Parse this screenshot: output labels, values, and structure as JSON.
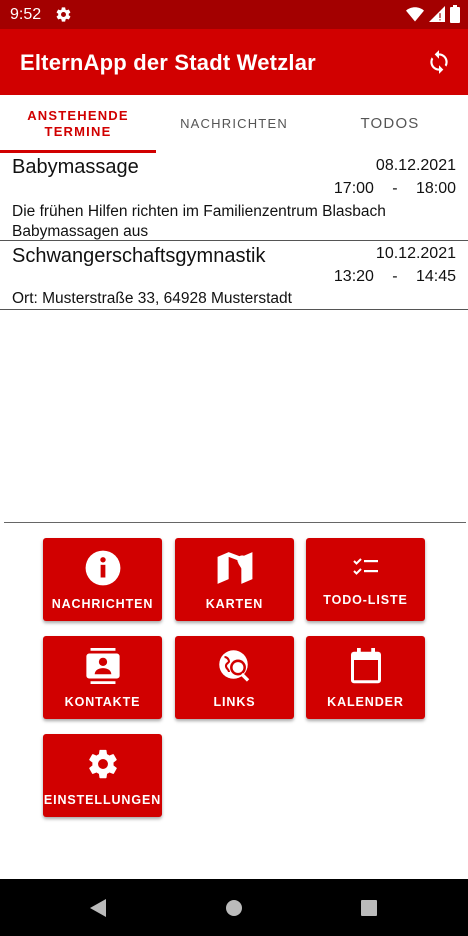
{
  "status_bar": {
    "time": "9:52"
  },
  "app_bar": {
    "title": "ElternApp der Stadt Wetzlar"
  },
  "tabs": [
    {
      "label": "ANSTEHENDE TERMINE",
      "active": true
    },
    {
      "label": "NACHRICHTEN",
      "active": false
    },
    {
      "label": "TODOS",
      "active": false
    }
  ],
  "events": [
    {
      "title": "Babymassage",
      "date": "08.12.2021",
      "start": "17:00",
      "separator": "-",
      "end": "18:00",
      "description": "Die frühen Hilfen richten im Familienzentrum Blasbach Babymassagen aus"
    },
    {
      "title": "Schwangerschaftsgymnastik",
      "date": "10.12.2021",
      "start": "13:20",
      "separator": "-",
      "end": "14:45",
      "description": "Ort: Musterstraße 33, 64928 Musterstadt"
    }
  ],
  "tiles": [
    {
      "label": "NACHRICHTEN",
      "icon": "info-icon"
    },
    {
      "label": "KARTEN",
      "icon": "map-icon"
    },
    {
      "label": "TODO-LISTE",
      "icon": "checklist-icon"
    },
    {
      "label": "KONTAKTE",
      "icon": "contacts-icon"
    },
    {
      "label": "LINKS",
      "icon": "web-search-icon"
    },
    {
      "label": "KALENDER",
      "icon": "calendar-icon"
    },
    {
      "label": "EINSTELLUNGEN",
      "icon": "gear-icon"
    }
  ],
  "colors": {
    "primary": "#d10000",
    "status_bar": "#a30000",
    "nav_bar": "#000000"
  }
}
